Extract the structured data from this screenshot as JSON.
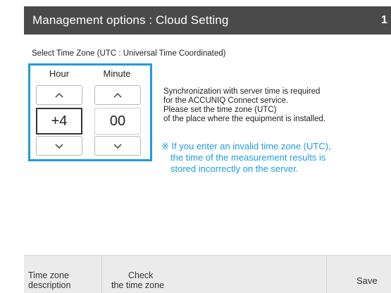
{
  "header": {
    "title": "Management options : Cloud Setting",
    "corner_glyph": "1"
  },
  "timezone": {
    "label": "Select Time Zone (UTC : Universal Time Coordinated)",
    "hour_label": "Hour",
    "minute_label": "Minute",
    "hour_value": "+4",
    "minute_value": "00"
  },
  "info": {
    "lines": [
      "Synchronization with server time is required",
      "for the ACCUNIQ Connect service.",
      "Please set the time zone (UTC)",
      "of the place where the equipment is installed."
    ]
  },
  "warning": {
    "lines": [
      "※ If you enter an invalid time zone (UTC),",
      "the time of the measurement results is",
      "stored incorrectly on the server."
    ],
    "color": "#1e9be0"
  },
  "footer": {
    "tz_desc_line1": "Time zone",
    "tz_desc_line2": "description",
    "check_line1": "Check",
    "check_line2": "the time zone",
    "save_label": "Save"
  },
  "colors": {
    "accent": "#1e9be0",
    "titlebar": "#4a4a4a",
    "footer_bg": "#ebebeb"
  }
}
